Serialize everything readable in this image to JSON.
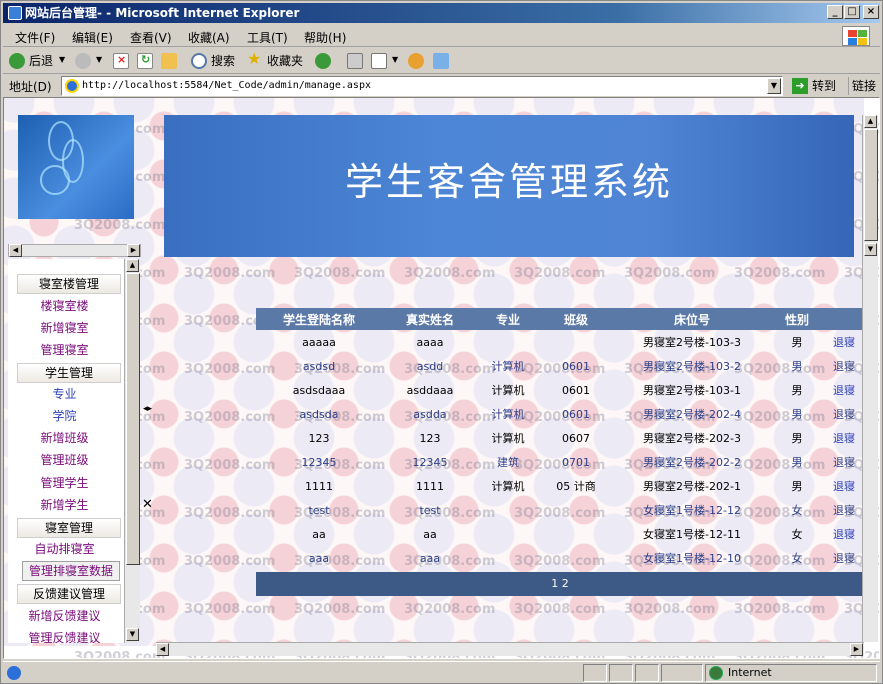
{
  "window": {
    "title": "网站后台管理- - Microsoft Internet Explorer",
    "minimize": "_",
    "maximize": "□",
    "close": "×"
  },
  "menubar": {
    "items": [
      "文件(F)",
      "编辑(E)",
      "查看(V)",
      "收藏(A)",
      "工具(T)",
      "帮助(H)"
    ]
  },
  "toolbar": {
    "back": "后退",
    "search": "搜索",
    "favorites": "收藏夹"
  },
  "address": {
    "label": "地址(D)",
    "url": "http://localhost:5584/Net_Code/admin/manage.aspx",
    "go": "转到",
    "links": "链接"
  },
  "sidebar": {
    "groups": [
      {
        "header": "寝室楼管理",
        "items": [
          {
            "label": "楼寝室楼",
            "style": "purple"
          },
          {
            "label": "新增寝室",
            "style": "purple"
          },
          {
            "label": "管理寝室",
            "style": "purple"
          }
        ]
      },
      {
        "header": "学生管理",
        "items": [
          {
            "label": "专业",
            "style": "blue"
          },
          {
            "label": "学院",
            "style": "blue"
          },
          {
            "label": "新增班级",
            "style": "purple"
          },
          {
            "label": "管理班级",
            "style": "purple"
          },
          {
            "label": "管理学生",
            "style": "purple"
          },
          {
            "label": "新增学生",
            "style": "purple"
          }
        ]
      },
      {
        "header": "寝室管理",
        "items": [
          {
            "label": "自动排寝室",
            "style": "purple"
          },
          {
            "label": "管理排寝室数据",
            "style": "selected"
          }
        ]
      },
      {
        "header": "反馈建议管理",
        "items": [
          {
            "label": "新增反馈建议",
            "style": "purple"
          },
          {
            "label": "管理反馈建议",
            "style": "purple"
          }
        ]
      }
    ],
    "toggle": "◂▸",
    "close": "✕"
  },
  "banner": {
    "title": "学生客舍管理系统"
  },
  "watermark": "3Q2008.com",
  "table": {
    "headers": [
      "学生登陆名称",
      "真实姓名",
      "专业",
      "班级",
      "床位号",
      "性别",
      ""
    ],
    "rows": [
      [
        "aaaaa",
        "aaaa",
        "",
        "",
        "男寝室2号楼-103-3",
        "男",
        "退寝"
      ],
      [
        "asdsd",
        "asdd",
        "计算机",
        "0601",
        "男寝室2号楼-103-2",
        "男",
        "退寝"
      ],
      [
        "asdsdaaa",
        "asddaaa",
        "计算机",
        "0601",
        "男寝室2号楼-103-1",
        "男",
        "退寝"
      ],
      [
        "asdsda",
        "asdda",
        "计算机",
        "0601",
        "男寝室2号楼-202-4",
        "男",
        "退寝"
      ],
      [
        "123",
        "123",
        "计算机",
        "0607",
        "男寝室2号楼-202-3",
        "男",
        "退寝"
      ],
      [
        "12345",
        "12345",
        "建筑",
        "0701",
        "男寝室2号楼-202-2",
        "男",
        "退寝"
      ],
      [
        "1111",
        "1111",
        "计算机",
        "05 计商",
        "男寝室2号楼-202-1",
        "男",
        "退寝"
      ],
      [
        "test",
        "test",
        "",
        "",
        "女寝室1号楼-12-12",
        "女",
        "退寝"
      ],
      [
        "aa",
        "aa",
        "",
        "",
        "女寝室1号楼-12-11",
        "女",
        "退寝"
      ],
      [
        "aaa",
        "aaa",
        "",
        "",
        "女寝室1号楼-12-10",
        "女",
        "退寝"
      ]
    ],
    "pager": "1 2"
  },
  "statusbar": {
    "zone": "Internet"
  }
}
